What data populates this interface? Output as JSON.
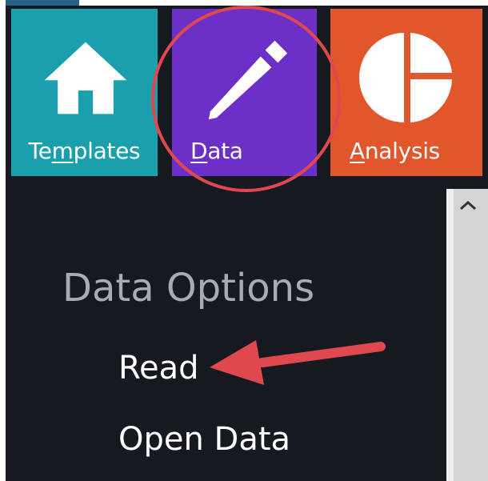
{
  "ribbon": {
    "tiles": [
      {
        "label_underlined": "m",
        "label_before": "Te",
        "label_after": "plates",
        "color": "#1aa0ad",
        "icon": "home-icon"
      },
      {
        "label_underlined": "D",
        "label_before": "",
        "label_after": "ata",
        "color": "#6c2fc7",
        "icon": "pencil-icon"
      },
      {
        "label_underlined": "A",
        "label_before": "",
        "label_after": "nalysis",
        "color": "#e2562b",
        "icon": "pie-chart-icon"
      }
    ]
  },
  "panel": {
    "title": "Data Options",
    "items": [
      {
        "label": "Read"
      },
      {
        "label": "Open Data"
      }
    ]
  },
  "annotations": {
    "highlight_color": "#e0484f"
  }
}
